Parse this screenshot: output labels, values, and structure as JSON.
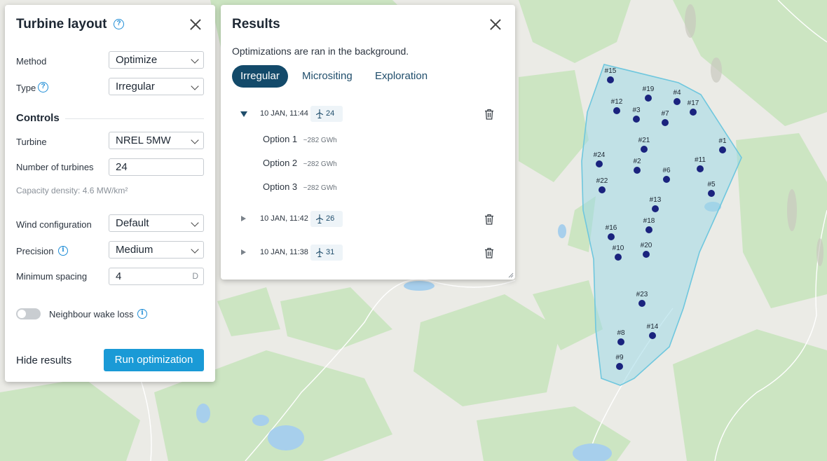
{
  "layout_panel": {
    "title": "Turbine layout",
    "help_icon": "help-icon",
    "method": {
      "label": "Method",
      "value": "Optimize"
    },
    "type": {
      "label": "Type",
      "value": "Irregular"
    },
    "controls_heading": "Controls",
    "turbine": {
      "label": "Turbine",
      "value": "NREL 5MW"
    },
    "number_of_turbines": {
      "label": "Number of turbines",
      "value": "24"
    },
    "capacity_density": "Capacity density: 4.6 MW/km²",
    "wind_configuration": {
      "label": "Wind configuration",
      "value": "Default"
    },
    "precision": {
      "label": "Precision",
      "value": "Medium"
    },
    "minimum_spacing": {
      "label": "Minimum spacing",
      "value": "4",
      "unit": "D"
    },
    "neighbour_wake_loss": {
      "label": "Neighbour wake loss",
      "enabled": false
    },
    "hide_results_label": "Hide results",
    "run_button_label": "Run optimization"
  },
  "results_panel": {
    "title": "Results",
    "subtitle": "Optimizations are ran in the background.",
    "tabs": [
      {
        "label": "Irregular",
        "active": true
      },
      {
        "label": "Micrositing",
        "active": false
      },
      {
        "label": "Exploration",
        "active": false
      }
    ],
    "runs": [
      {
        "date": "10 JAN, 11:44",
        "turbines": "24",
        "expanded": true,
        "options": [
          {
            "label": "Option 1",
            "value": "~282 GWh"
          },
          {
            "label": "Option 2",
            "value": "~282 GWh"
          },
          {
            "label": "Option 3",
            "value": "~282 GWh"
          }
        ]
      },
      {
        "date": "10 JAN, 11:42",
        "turbines": "26",
        "expanded": false
      },
      {
        "date": "10 JAN, 11:38",
        "turbines": "31",
        "expanded": false
      }
    ]
  },
  "map": {
    "turbine_labels": [
      "#15",
      "#19",
      "#4",
      "#12",
      "#3",
      "#17",
      "#7",
      "#21",
      "#1",
      "#24",
      "#2",
      "#11",
      "#6",
      "#22",
      "#5",
      "#13",
      "#18",
      "#16",
      "#10",
      "#20",
      "#23",
      "#14",
      "#8",
      "#9"
    ],
    "colors": {
      "area_fill": "#9fd9e6",
      "area_stroke": "#6fc7de",
      "turbine": "#1a237e",
      "forest": "#c9e3bf",
      "water": "#a8d0ec"
    }
  }
}
